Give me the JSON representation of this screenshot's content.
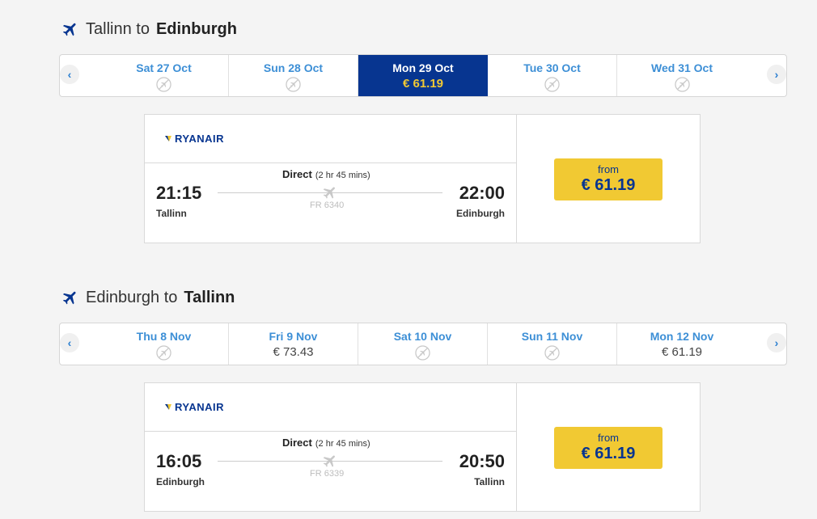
{
  "outbound": {
    "title_prefix": "Tallinn to",
    "title_dest": "Edinburgh",
    "dates": [
      {
        "label": "Sat 27 Oct",
        "price": null,
        "selected": false
      },
      {
        "label": "Sun 28 Oct",
        "price": null,
        "selected": false
      },
      {
        "label": "Mon 29 Oct",
        "price": "€ 61.19",
        "selected": true
      },
      {
        "label": "Tue 30 Oct",
        "price": null,
        "selected": false
      },
      {
        "label": "Wed 31 Oct",
        "price": null,
        "selected": false
      }
    ],
    "flight": {
      "airline": "RYANAIR",
      "direct_label": "Direct",
      "duration": "(2 hr 45 mins)",
      "flight_number": "FR 6340",
      "dep_time": "21:15",
      "dep_city": "Tallinn",
      "arr_time": "22:00",
      "arr_city": "Edinburgh",
      "from_label": "from",
      "price": "€ 61.19"
    }
  },
  "inbound": {
    "title_prefix": "Edinburgh to",
    "title_dest": "Tallinn",
    "dates": [
      {
        "label": "Thu 8 Nov",
        "price": null,
        "selected": false
      },
      {
        "label": "Fri 9 Nov",
        "price": "€ 73.43",
        "selected": false
      },
      {
        "label": "Sat 10 Nov",
        "price": null,
        "selected": false
      },
      {
        "label": "Sun 11 Nov",
        "price": null,
        "selected": false
      },
      {
        "label": "Mon 12 Nov",
        "price": "€ 61.19",
        "selected": false
      }
    ],
    "flight": {
      "airline": "RYANAIR",
      "direct_label": "Direct",
      "duration": "(2 hr 45 mins)",
      "flight_number": "FR 6339",
      "dep_time": "16:05",
      "dep_city": "Edinburgh",
      "arr_time": "20:50",
      "arr_city": "Tallinn",
      "from_label": "from",
      "price": "€ 61.19"
    }
  },
  "icons": {
    "title": "plane-icon",
    "nav_prev": "chevron-left-icon",
    "nav_next": "chevron-right-icon",
    "no_flight": "no-flights-icon",
    "route": "plane-icon",
    "brand": "ryanair-harp-logo"
  },
  "colors": {
    "brand_blue": "#073590",
    "link_blue": "#3d8fd6",
    "price_yellow": "#f1c933"
  }
}
